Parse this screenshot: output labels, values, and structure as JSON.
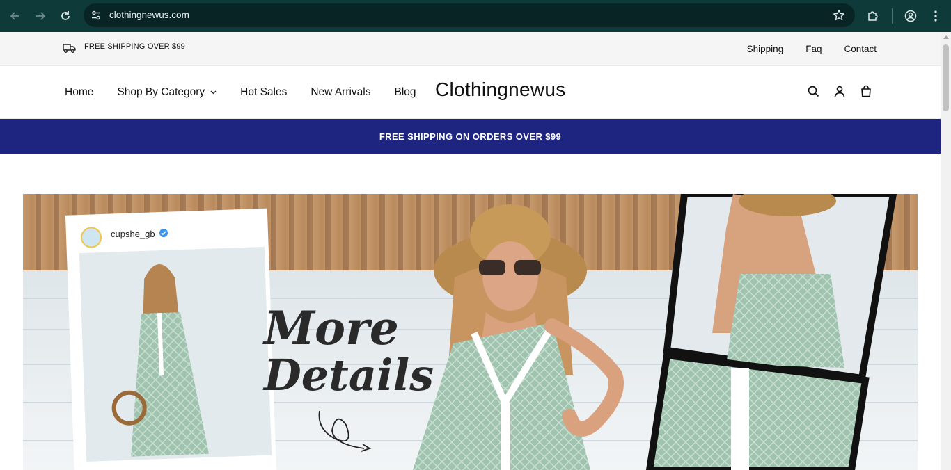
{
  "browser": {
    "url": "clothingnewus.com",
    "colors": {
      "chrome_bg": "#0f3a3a",
      "omnibox_bg": "#082425"
    }
  },
  "topbar": {
    "shipping_note": "FREE SHIPPING OVER $99",
    "links": [
      "Shipping",
      "Faq",
      "Contact"
    ]
  },
  "header": {
    "nav": [
      "Home",
      "Shop By Category",
      "Hot Sales",
      "New Arrivals",
      "Blog"
    ],
    "logo": "Clothingnewus"
  },
  "announcement": {
    "text": "FREE SHIPPING ON ORDERS OVER $99",
    "bg_color": "#1e2580"
  },
  "hero": {
    "username": "cupshe_gb",
    "headline_line1": "More",
    "headline_line2": "Details"
  }
}
